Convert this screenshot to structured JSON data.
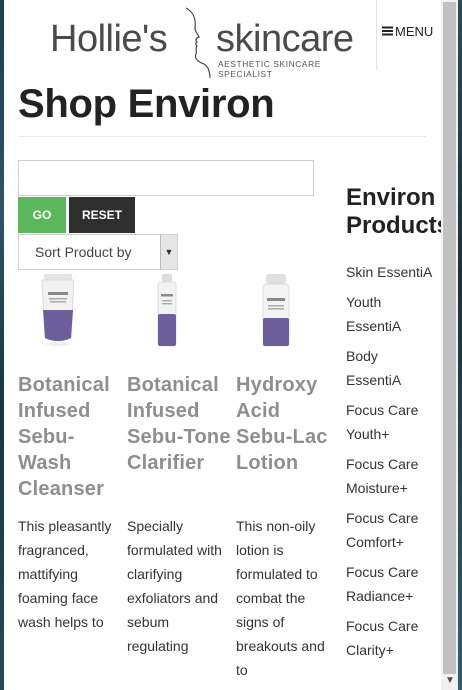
{
  "header": {
    "logo_left": "Hollie's",
    "logo_right": "skincare",
    "logo_tagline": "AESTHETIC SKINCARE SPECIALIST",
    "menu_label": "MENU",
    "menu_icon": "hamburger-icon"
  },
  "page": {
    "title": "Shop Environ"
  },
  "search": {
    "value": "",
    "placeholder": "",
    "go_label": "GO",
    "reset_label": "RESET",
    "go_color": "#5cb85c",
    "reset_color": "#2f2f2f"
  },
  "sort": {
    "selected": "Sort Product by"
  },
  "products": [
    {
      "name": "Botanical Infused Sebu-Wash Cleanser",
      "description": "This pleasantly fragranced, mattifying foaming face wash helps to",
      "brand_on_pack": "ENVIRON"
    },
    {
      "name": "Botanical Infused Sebu-Tone Clarifier",
      "description": "Specially formulated with clarifying exfoliators and sebum regulating",
      "brand_on_pack": "ENVIRON"
    },
    {
      "name": "Hydroxy Acid Sebu-Lac Lotion",
      "description": "This non-oily lotion is formulated to combat the signs of breakouts and to",
      "brand_on_pack": "ENVIRON"
    }
  ],
  "sidebar": {
    "title_line1": "Environ",
    "title_line2": "Products",
    "items": [
      {
        "label": "Skin EssentiA"
      },
      {
        "label": "Youth EssentiA"
      },
      {
        "label": "Body EssentiA"
      },
      {
        "label": "Focus Care Youth+"
      },
      {
        "label": "Focus Care Moisture+"
      },
      {
        "label": "Focus Care Comfort+"
      },
      {
        "label": "Focus Care Radiance+"
      },
      {
        "label": "Focus Care Clarity+"
      }
    ]
  },
  "colors": {
    "product_name": "#8e8e8e",
    "title": "#222222",
    "pack_purple": "#6d5e9c"
  }
}
